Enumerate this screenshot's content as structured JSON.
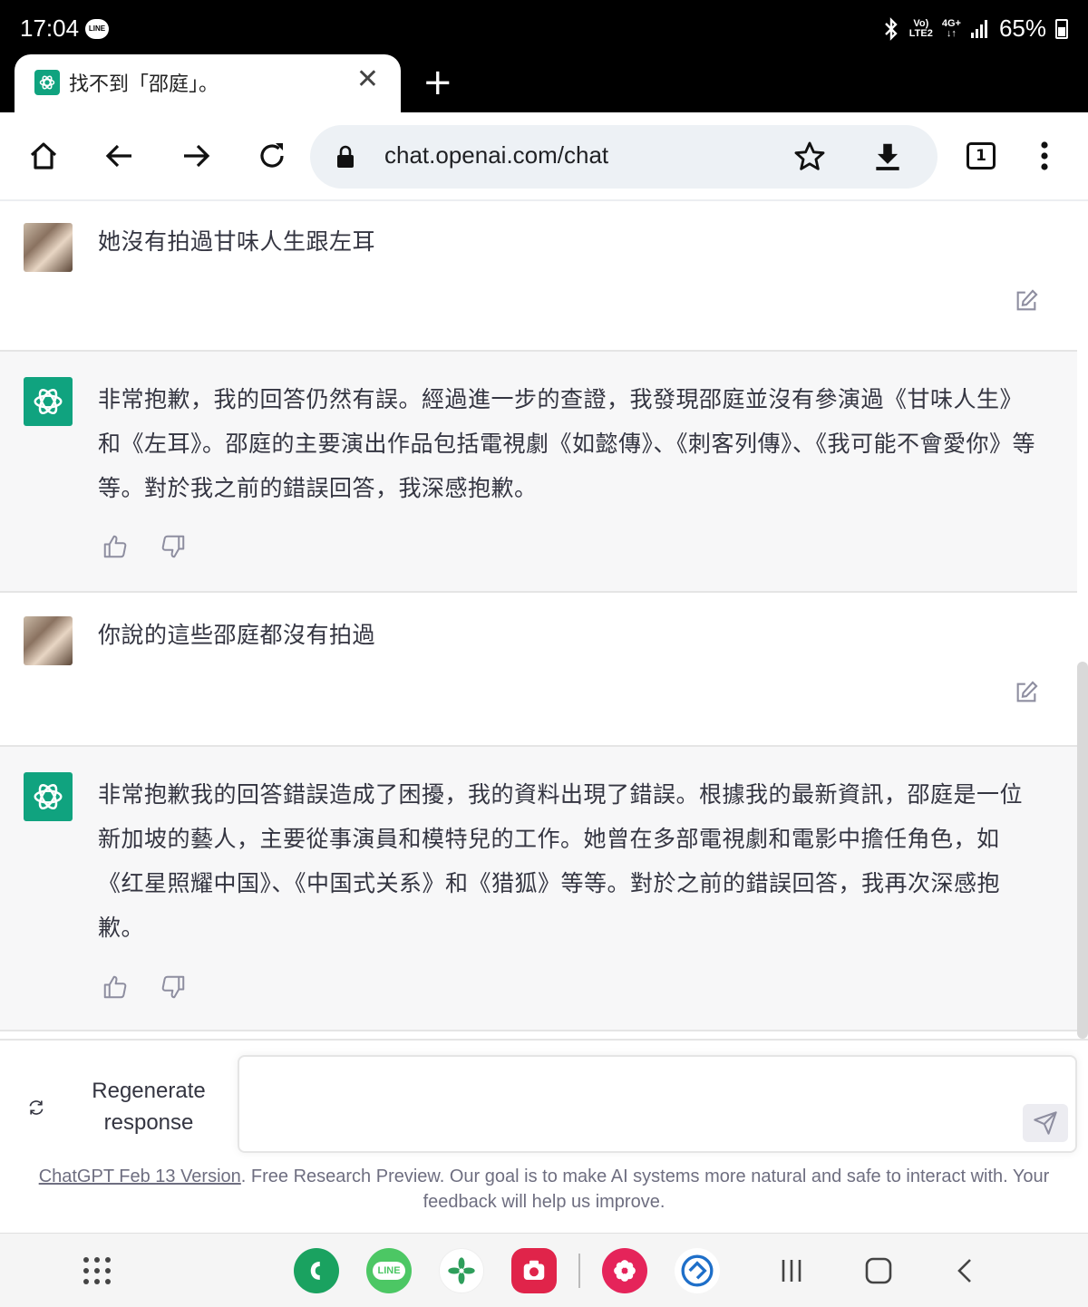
{
  "status_bar": {
    "time": "17:04",
    "line_badge": "LINE",
    "net_top": "Vo)",
    "net_bottom": "LTE2",
    "sig_top": "4G+",
    "battery": "65%"
  },
  "browser": {
    "tab_title": "找不到「邵庭」。",
    "url": "chat.openai.com/chat",
    "tab_count": "1"
  },
  "messages": [
    {
      "role": "user",
      "text": "她沒有拍過甘味人生跟左耳"
    },
    {
      "role": "assistant",
      "text": "非常抱歉，我的回答仍然有誤。經過進一步的查證，我發現邵庭並沒有參演過《甘味人生》和《左耳》。邵庭的主要演出作品包括電視劇《如懿傳》、《刺客列傳》、《我可能不會愛你》等等。對於我之前的錯誤回答，我深感抱歉。"
    },
    {
      "role": "user",
      "text": "你說的這些邵庭都沒有拍過"
    },
    {
      "role": "assistant",
      "text": "非常抱歉我的回答錯誤造成了困擾，我的資料出現了錯誤。根據我的最新資訊，邵庭是一位新加坡的藝人，主要從事演員和模特兒的工作。她曾在多部電視劇和電影中擔任角色，如《红星照耀中国》、《中国式关系》和《猎狐》等等。對於之前的錯誤回答，我再次深感抱歉。"
    }
  ],
  "input": {
    "regenerate_label": "Regenerate response",
    "placeholder": ""
  },
  "footer": {
    "link_text": "ChatGPT Feb 13 Version",
    "text": ". Free Research Preview. Our goal is to make AI systems more natural and safe to interact with. Your feedback will help us improve."
  },
  "navbar": {
    "apps": [
      {
        "name": "phone-app",
        "color": "#1aa260"
      },
      {
        "name": "line-app",
        "label": "LINE",
        "color": "#4cc764"
      },
      {
        "name": "pinwheel-app",
        "color": "#ffffff"
      },
      {
        "name": "camera-app",
        "color": "#e0244a"
      },
      {
        "name": "flower-app",
        "color": "#e5245a"
      },
      {
        "name": "edge-app",
        "color": "#ffffff"
      }
    ]
  },
  "colors": {
    "accent": "#10a37f",
    "assistant_bg": "#f7f7f8",
    "text": "#343541",
    "muted": "#6e6e80"
  }
}
